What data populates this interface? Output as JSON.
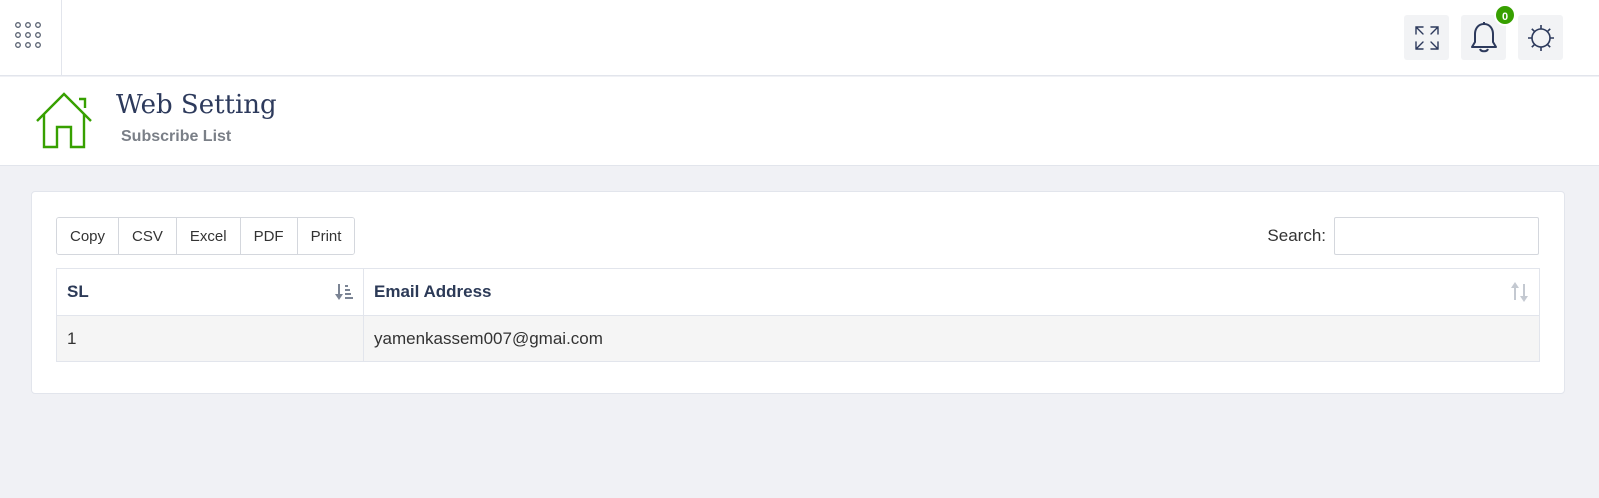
{
  "header": {
    "notification_count": "0",
    "icons": {
      "menu": "grid-dots-icon",
      "fullscreen": "expand-icon",
      "notifications": "bell-icon",
      "settings": "gear-icon"
    },
    "accent_color": "#37a000"
  },
  "page": {
    "title": "Web Setting",
    "subtitle": "Subscribe List",
    "icon": "home-icon"
  },
  "toolbar": {
    "buttons": [
      "Copy",
      "CSV",
      "Excel",
      "PDF",
      "Print"
    ],
    "search_label": "Search:",
    "search_value": ""
  },
  "table": {
    "columns": [
      "SL",
      "Email Address"
    ],
    "rows": [
      [
        "1",
        "yamenkassem007@gmai.com"
      ]
    ]
  }
}
